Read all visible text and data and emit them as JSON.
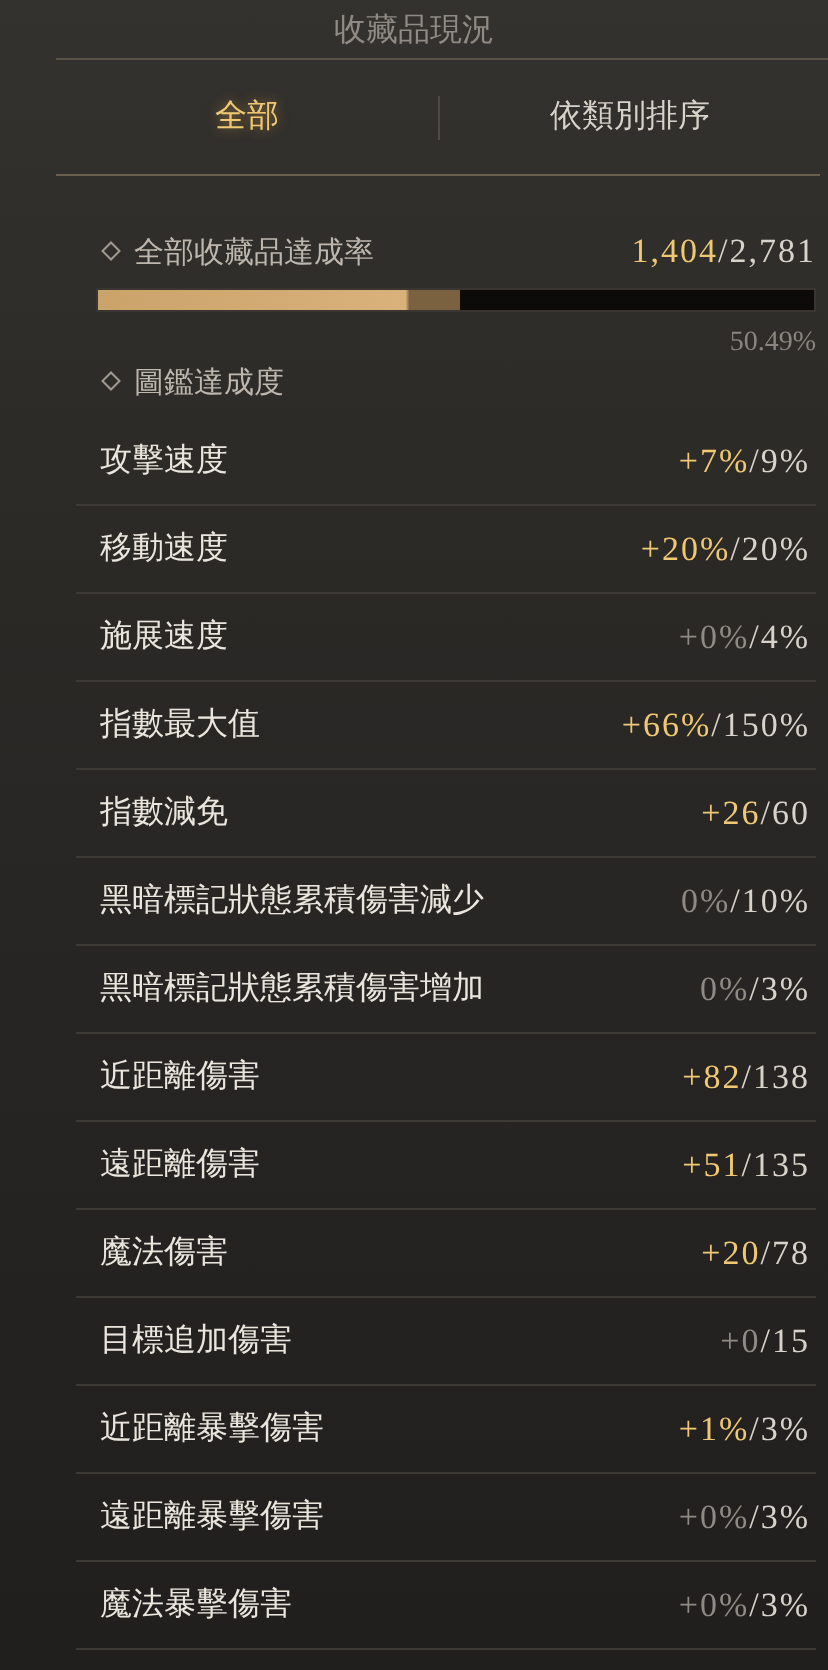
{
  "title": "收藏品現況",
  "tabs": [
    {
      "label": "全部",
      "selected": true
    },
    {
      "label": "依類別排序",
      "selected": false
    }
  ],
  "total": {
    "label": "全部收藏品達成率",
    "current": "1,404",
    "max": "/2,781",
    "level": 0.5049,
    "percent": "50.49%"
  },
  "section": {
    "label": "圖鑑達成度"
  },
  "stats": [
    {
      "name": "攻擊速度",
      "current": "+7%",
      "max": "/9%",
      "active": true
    },
    {
      "name": "移動速度",
      "current": "+20%",
      "max": "/20%",
      "active": true
    },
    {
      "name": "施展速度",
      "current": "+0%",
      "max": "/4%",
      "active": false
    },
    {
      "name": "指數最大值",
      "current": "+66%",
      "max": "/150%",
      "active": true
    },
    {
      "name": "指數減免",
      "current": "+26",
      "max": "/60",
      "active": true
    },
    {
      "name": "黑暗標記狀態累積傷害減少",
      "current": "0%",
      "max": "/10%",
      "active": false
    },
    {
      "name": "黑暗標記狀態累積傷害增加",
      "current": "0%",
      "max": "/3%",
      "active": false
    },
    {
      "name": "近距離傷害",
      "current": "+82",
      "max": "/138",
      "active": true
    },
    {
      "name": "遠距離傷害",
      "current": "+51",
      "max": "/135",
      "active": true
    },
    {
      "name": "魔法傷害",
      "current": "+20",
      "max": "/78",
      "active": true
    },
    {
      "name": "目標追加傷害",
      "current": "+0",
      "max": "/15",
      "active": false
    },
    {
      "name": "近距離暴擊傷害",
      "current": "+1%",
      "max": "/3%",
      "active": true
    },
    {
      "name": "遠距離暴擊傷害",
      "current": "+0%",
      "max": "/3%",
      "active": false
    },
    {
      "name": "魔法暴擊傷害",
      "current": "+0%",
      "max": "/3%",
      "active": false
    }
  ]
}
